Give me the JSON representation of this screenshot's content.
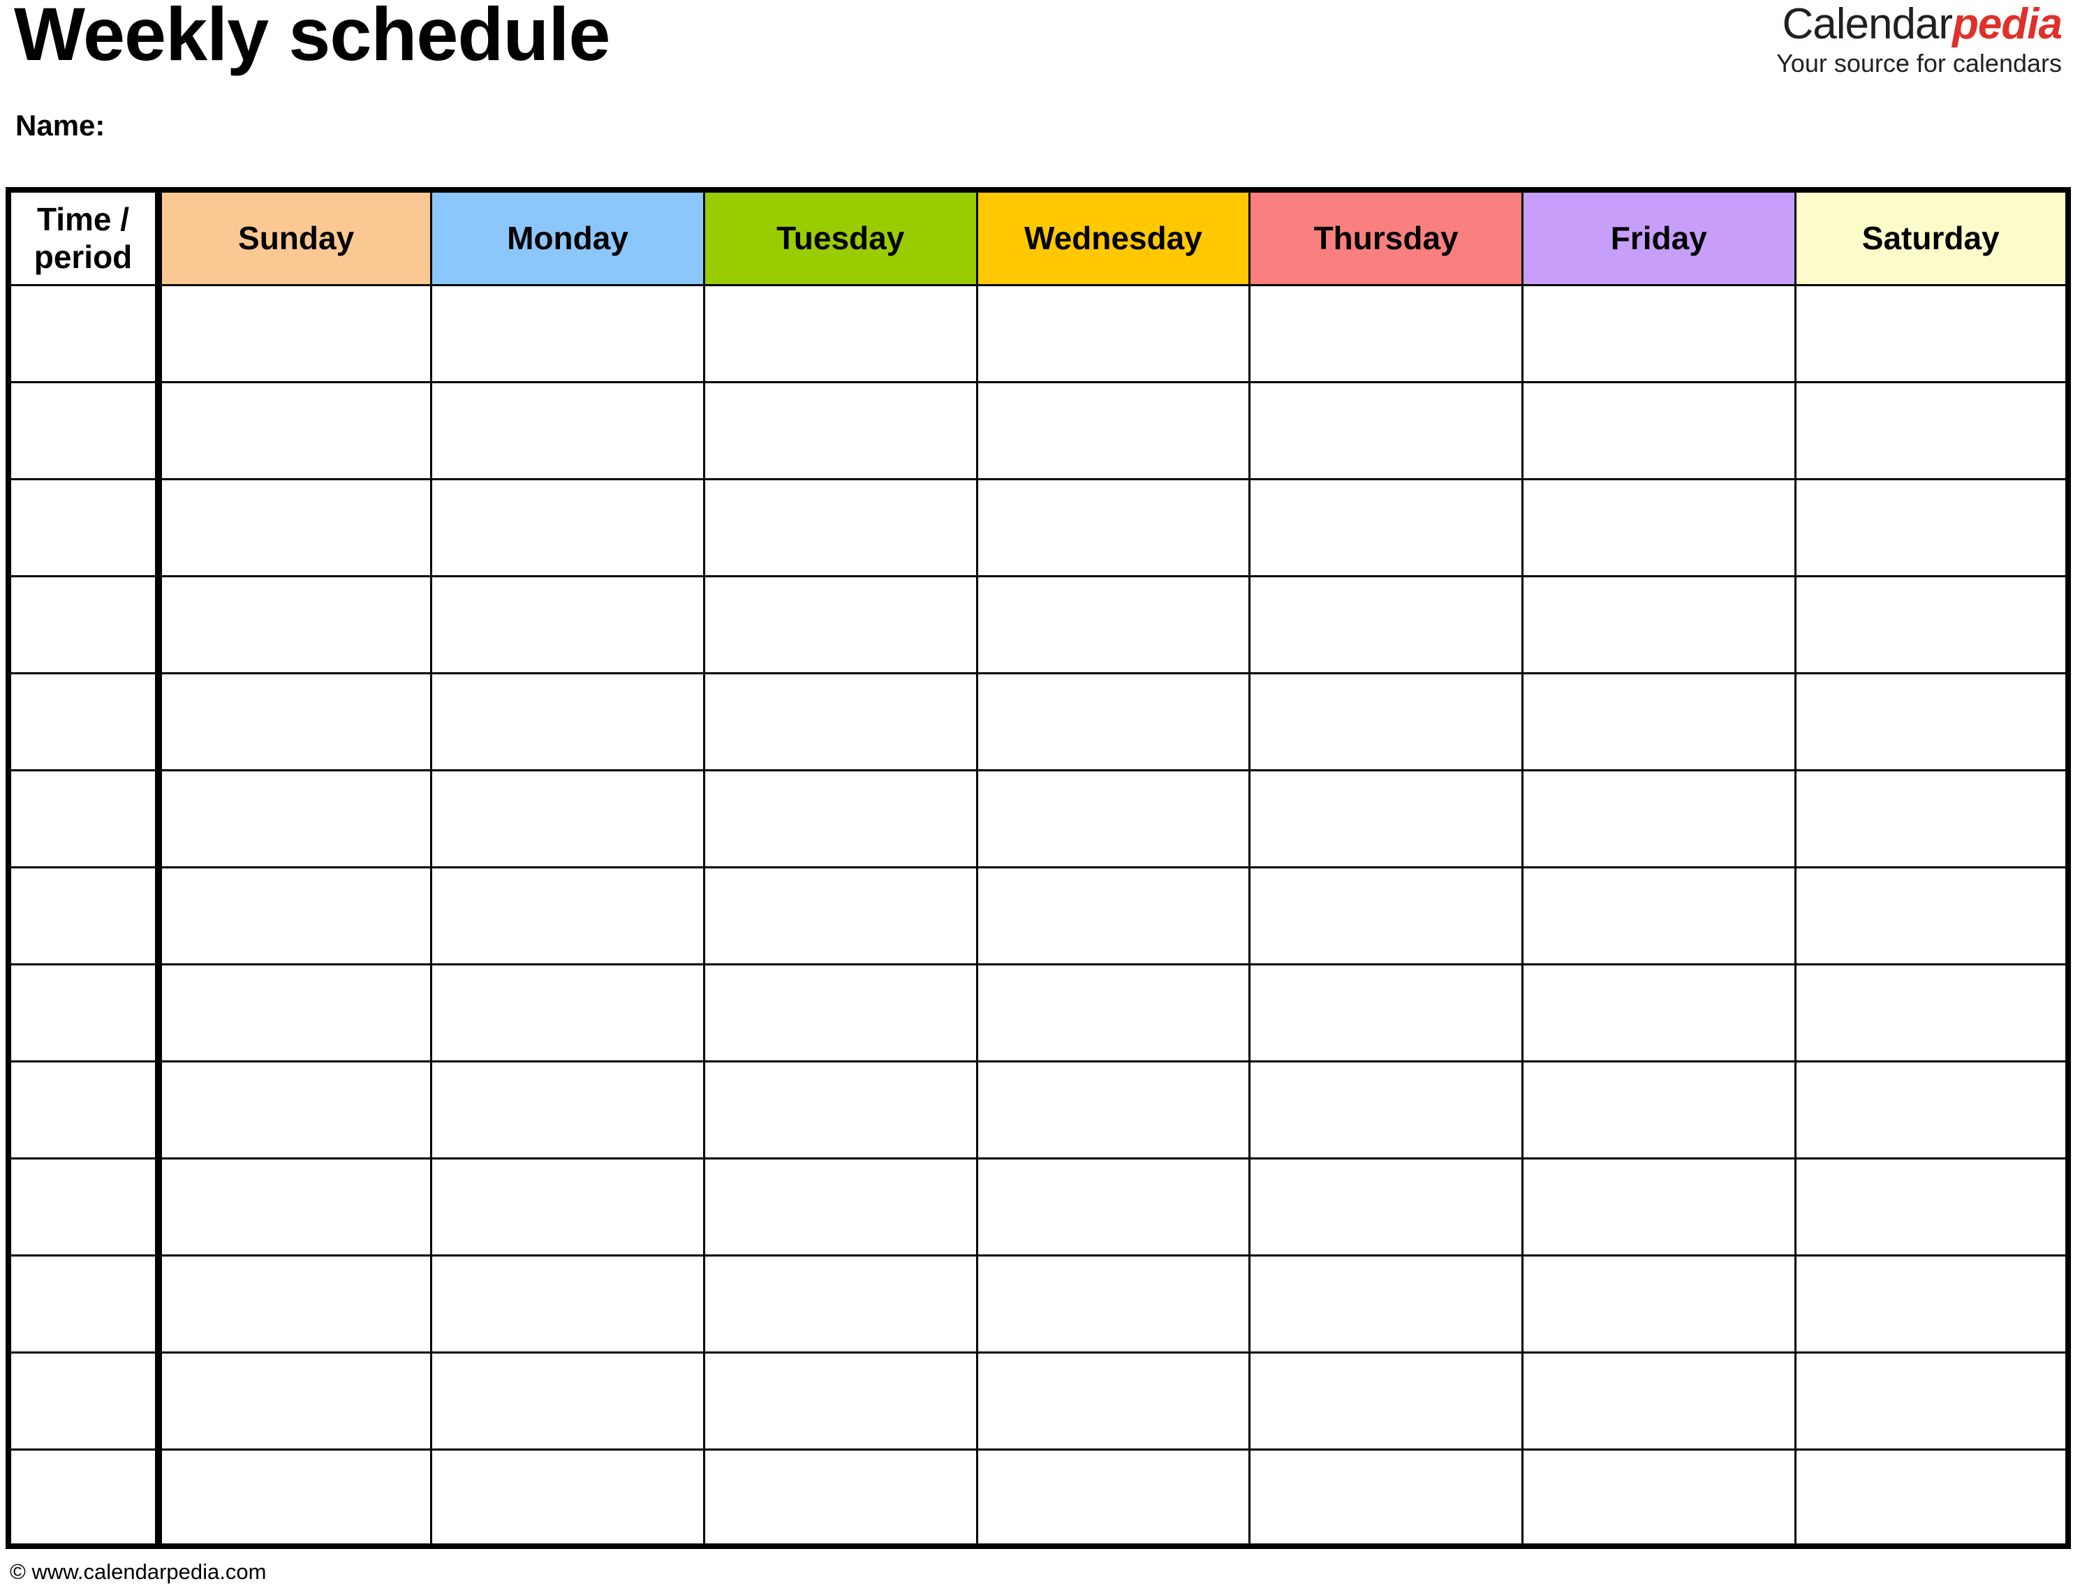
{
  "document": {
    "title": "Weekly schedule",
    "name_label": "Name:"
  },
  "brand": {
    "name_part1": "Calendar",
    "name_part2": "pedia",
    "tagline": "Your source for calendars",
    "color_part1": "#231f20",
    "color_part2": "#e0302a"
  },
  "table": {
    "time_column_header": "Time / period",
    "day_headers": [
      {
        "label": "Sunday",
        "color": "#fbc894"
      },
      {
        "label": "Monday",
        "color": "#8cc7fb"
      },
      {
        "label": "Tuesday",
        "color": "#9acd00"
      },
      {
        "label": "Wednesday",
        "color": "#ffc800"
      },
      {
        "label": "Thursday",
        "color": "#fa7f7f"
      },
      {
        "label": "Friday",
        "color": "#c79ffa"
      },
      {
        "label": "Saturday",
        "color": "#fcfbca"
      }
    ],
    "row_count": 13,
    "rows": [
      {
        "time": "",
        "cells": [
          "",
          "",
          "",
          "",
          "",
          "",
          ""
        ]
      },
      {
        "time": "",
        "cells": [
          "",
          "",
          "",
          "",
          "",
          "",
          ""
        ]
      },
      {
        "time": "",
        "cells": [
          "",
          "",
          "",
          "",
          "",
          "",
          ""
        ]
      },
      {
        "time": "",
        "cells": [
          "",
          "",
          "",
          "",
          "",
          "",
          ""
        ]
      },
      {
        "time": "",
        "cells": [
          "",
          "",
          "",
          "",
          "",
          "",
          ""
        ]
      },
      {
        "time": "",
        "cells": [
          "",
          "",
          "",
          "",
          "",
          "",
          ""
        ]
      },
      {
        "time": "",
        "cells": [
          "",
          "",
          "",
          "",
          "",
          "",
          ""
        ]
      },
      {
        "time": "",
        "cells": [
          "",
          "",
          "",
          "",
          "",
          "",
          ""
        ]
      },
      {
        "time": "",
        "cells": [
          "",
          "",
          "",
          "",
          "",
          "",
          ""
        ]
      },
      {
        "time": "",
        "cells": [
          "",
          "",
          "",
          "",
          "",
          "",
          ""
        ]
      },
      {
        "time": "",
        "cells": [
          "",
          "",
          "",
          "",
          "",
          "",
          ""
        ]
      },
      {
        "time": "",
        "cells": [
          "",
          "",
          "",
          "",
          "",
          "",
          ""
        ]
      },
      {
        "time": "",
        "cells": [
          "",
          "",
          "",
          "",
          "",
          "",
          ""
        ]
      }
    ]
  },
  "footer": {
    "copyright": "© www.calendarpedia.com"
  }
}
